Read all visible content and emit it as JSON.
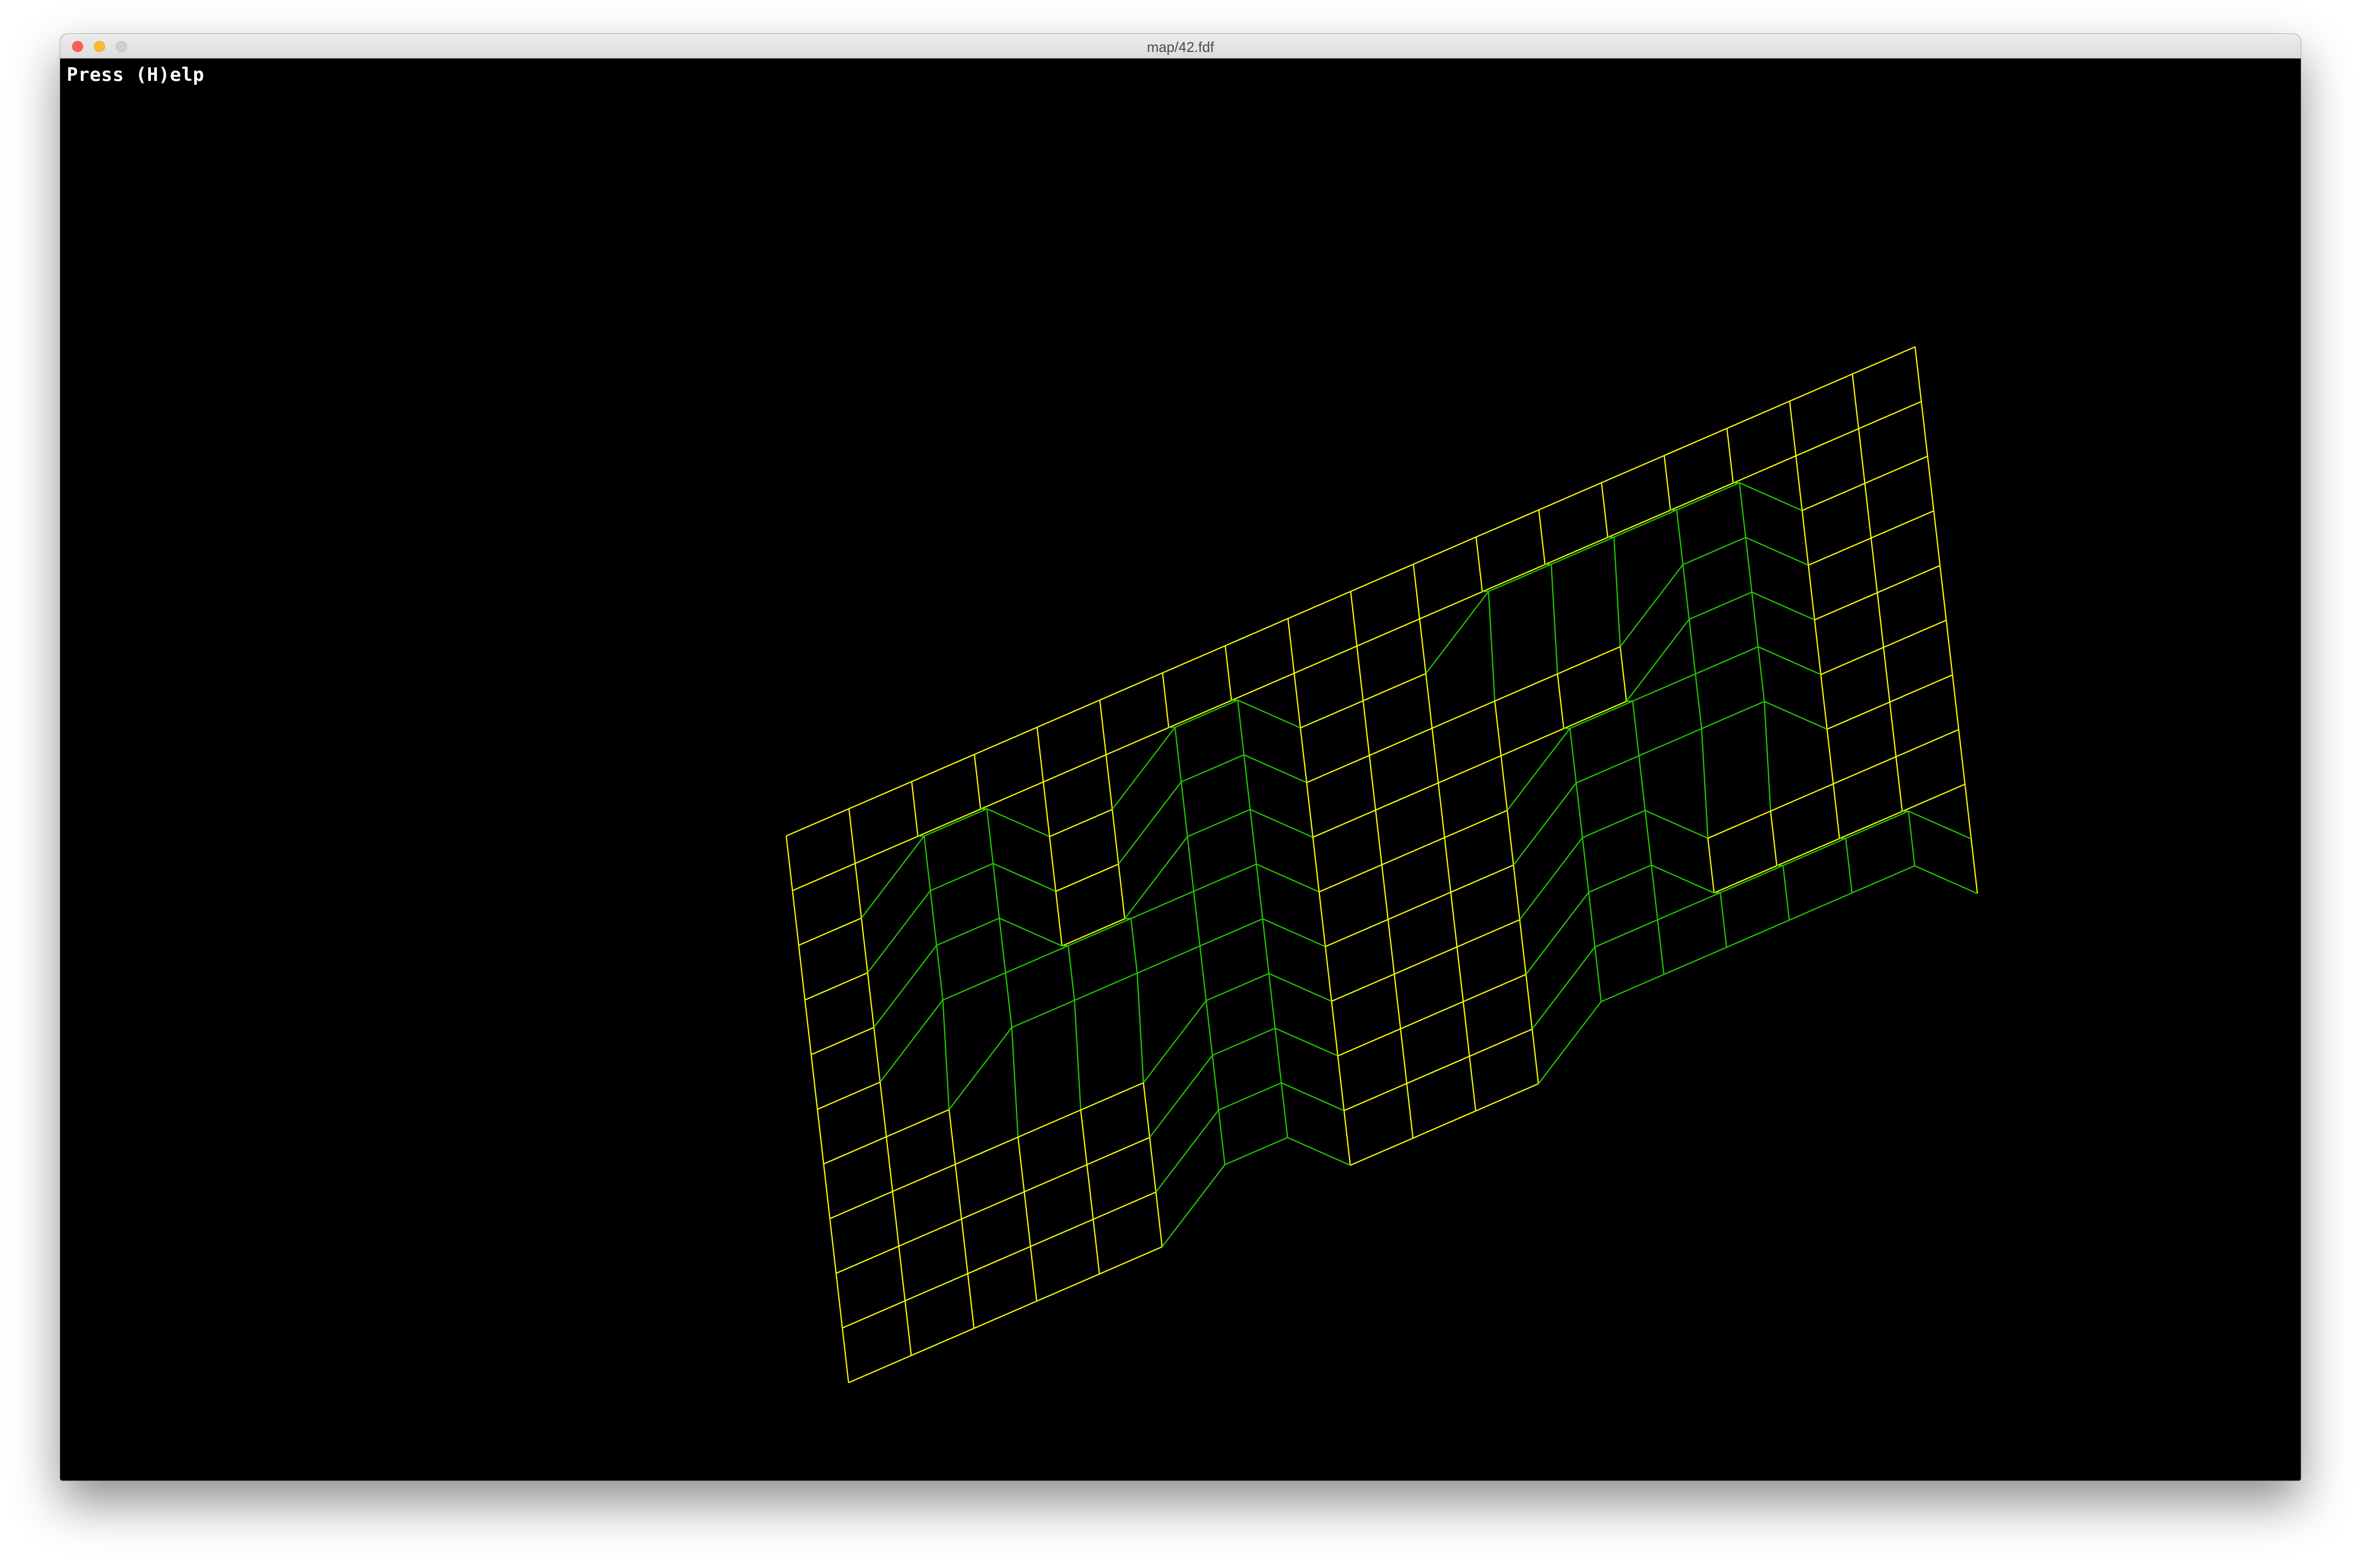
{
  "window": {
    "title": "map/42.fdf"
  },
  "canvas": {
    "help_text": "Press (H)elp",
    "background_color": "#000000"
  },
  "wireframe": {
    "map_file": "map/42.fdf",
    "projection": "isometric",
    "columns": 19,
    "rows": 11,
    "z_max": 10,
    "low_color": "#ffff00",
    "high_color": "#22cc00",
    "heights": [
      [
        0,
        0,
        0,
        0,
        0,
        0,
        0,
        0,
        0,
        0,
        0,
        0,
        0,
        0,
        0,
        0,
        0,
        0,
        0
      ],
      [
        0,
        0,
        0,
        0,
        0,
        0,
        0,
        0,
        0,
        0,
        0,
        0,
        0,
        0,
        0,
        0,
        0,
        0,
        0
      ],
      [
        0,
        0,
        10,
        10,
        0,
        0,
        10,
        10,
        0,
        0,
        0,
        10,
        10,
        10,
        10,
        10,
        0,
        0,
        0
      ],
      [
        0,
        0,
        10,
        10,
        0,
        0,
        10,
        10,
        0,
        0,
        0,
        0,
        0,
        0,
        10,
        10,
        0,
        0,
        0
      ],
      [
        0,
        0,
        10,
        10,
        0,
        0,
        10,
        10,
        0,
        0,
        0,
        0,
        0,
        0,
        10,
        10,
        0,
        0,
        0
      ],
      [
        0,
        0,
        10,
        10,
        10,
        10,
        10,
        10,
        0,
        0,
        0,
        0,
        10,
        10,
        10,
        10,
        0,
        0,
        0
      ],
      [
        0,
        0,
        0,
        10,
        10,
        10,
        10,
        10,
        0,
        0,
        0,
        0,
        10,
        10,
        10,
        10,
        0,
        0,
        0
      ],
      [
        0,
        0,
        0,
        0,
        0,
        0,
        10,
        10,
        0,
        0,
        0,
        0,
        10,
        10,
        0,
        0,
        0,
        0,
        0
      ],
      [
        0,
        0,
        0,
        0,
        0,
        0,
        10,
        10,
        0,
        0,
        0,
        0,
        10,
        10,
        0,
        0,
        0,
        0,
        0
      ],
      [
        0,
        0,
        0,
        0,
        0,
        0,
        10,
        10,
        0,
        0,
        0,
        0,
        10,
        10,
        10,
        10,
        10,
        10,
        0
      ],
      [
        0,
        0,
        0,
        0,
        0,
        0,
        10,
        10,
        0,
        0,
        0,
        0,
        10,
        10,
        10,
        10,
        10,
        10,
        0
      ]
    ]
  }
}
